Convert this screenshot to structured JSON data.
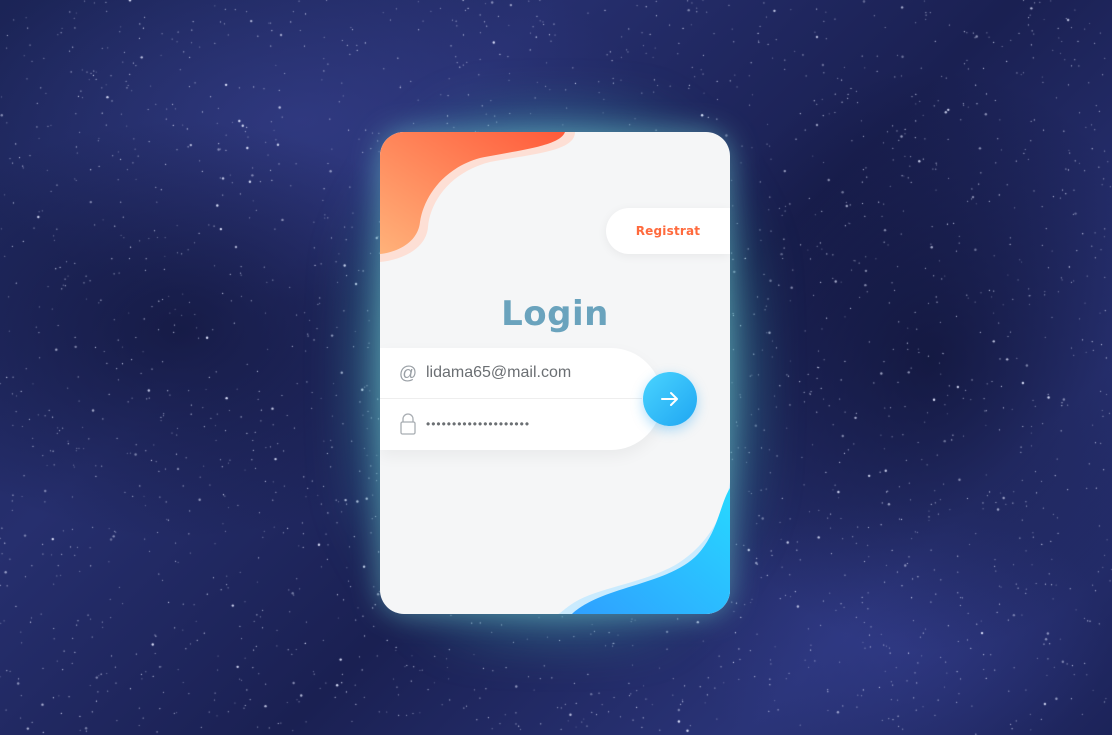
{
  "register": {
    "label": "Registrat"
  },
  "login": {
    "title": "Login",
    "email": {
      "icon": "at-sign-icon",
      "value": "lidama65@mail.com"
    },
    "password": {
      "icon": "lock-icon",
      "value": "••••••••••••••••••••"
    },
    "submit": {
      "icon": "arrow-right-icon"
    }
  },
  "colors": {
    "accent_orange": "#ff6a3d",
    "accent_blue": "#1fa6f2",
    "title": "#6aa3bd",
    "card_bg": "#f5f6f7"
  }
}
